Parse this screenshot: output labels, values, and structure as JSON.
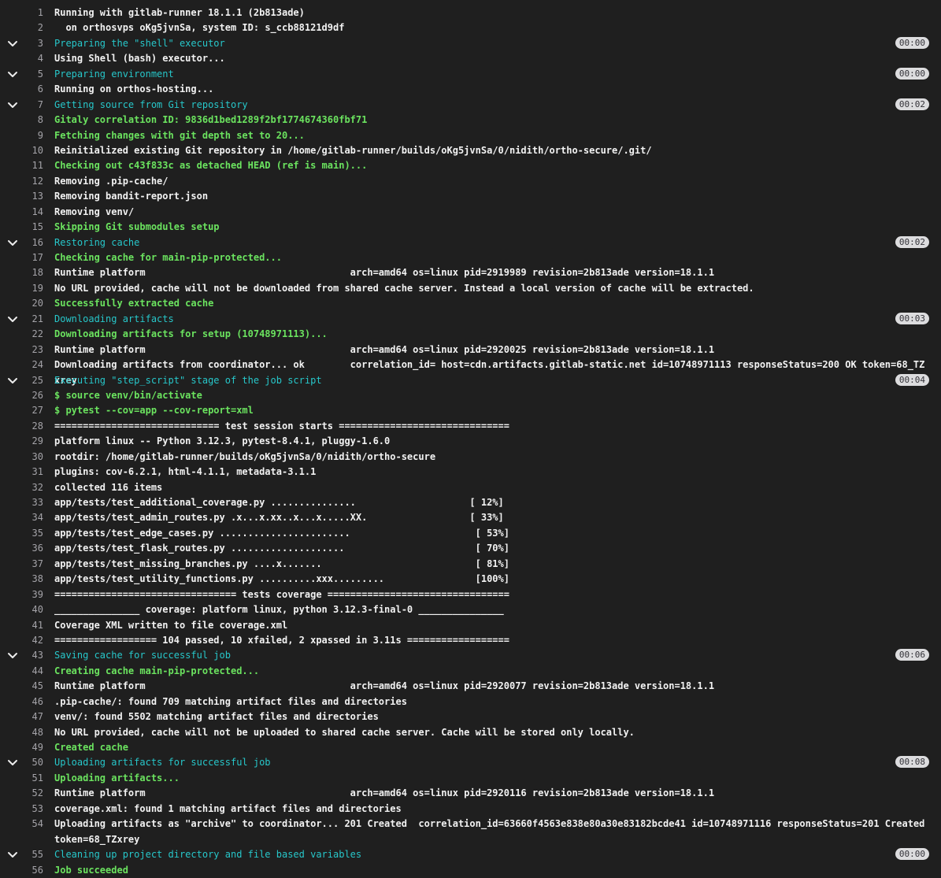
{
  "job_log": {
    "lines": [
      {
        "n": "1",
        "text": "Running with gitlab-runner 18.1.1 (2b813ade)",
        "c": "bold"
      },
      {
        "n": "2",
        "text": "  on orthosvps oKg5jvnSa, system ID: s_ccb88121d9df",
        "c": "bold"
      },
      {
        "n": "3",
        "text": "Preparing the \"shell\" executor",
        "c": "cyan",
        "section": true,
        "duration": "00:00"
      },
      {
        "n": "4",
        "text": "Using Shell (bash) executor...",
        "c": "bold"
      },
      {
        "n": "5",
        "text": "Preparing environment",
        "c": "cyan",
        "section": true,
        "duration": "00:00"
      },
      {
        "n": "6",
        "text": "Running on orthos-hosting...",
        "c": "bold"
      },
      {
        "n": "7",
        "text": "Getting source from Git repository",
        "c": "cyan",
        "section": true,
        "duration": "00:02"
      },
      {
        "n": "8",
        "text": "Gitaly correlation ID: 9836d1bed1289f2bf1774674360fbf71",
        "c": "green"
      },
      {
        "n": "9",
        "text": "Fetching changes with git depth set to 20...",
        "c": "green"
      },
      {
        "n": "10",
        "text": "Reinitialized existing Git repository in /home/gitlab-runner/builds/oKg5jvnSa/0/nidith/ortho-secure/.git/",
        "c": "bold"
      },
      {
        "n": "11",
        "text": "Checking out c43f833c as detached HEAD (ref is main)...",
        "c": "green"
      },
      {
        "n": "12",
        "text": "Removing .pip-cache/",
        "c": "bold"
      },
      {
        "n": "13",
        "text": "Removing bandit-report.json",
        "c": "bold"
      },
      {
        "n": "14",
        "text": "Removing venv/",
        "c": "bold"
      },
      {
        "n": "15",
        "text": "Skipping Git submodules setup",
        "c": "green"
      },
      {
        "n": "16",
        "text": "Restoring cache",
        "c": "cyan",
        "section": true,
        "duration": "00:02"
      },
      {
        "n": "17",
        "text": "Checking cache for main-pip-protected...",
        "c": "green"
      },
      {
        "n": "18",
        "text": "Runtime platform                                    arch=amd64 os=linux pid=2919989 revision=2b813ade version=18.1.1",
        "c": "bold"
      },
      {
        "n": "19",
        "text": "No URL provided, cache will not be downloaded from shared cache server. Instead a local version of cache will be extracted.",
        "c": "bold"
      },
      {
        "n": "20",
        "text": "Successfully extracted cache",
        "c": "green"
      },
      {
        "n": "21",
        "text": "Downloading artifacts",
        "c": "cyan",
        "section": true,
        "duration": "00:03"
      },
      {
        "n": "22",
        "text": "Downloading artifacts for setup (10748971113)...",
        "c": "green"
      },
      {
        "n": "23",
        "text": "Runtime platform                                    arch=amd64 os=linux pid=2920025 revision=2b813ade version=18.1.1",
        "c": "bold"
      },
      {
        "n": "24",
        "text": "Downloading artifacts from coordinator... ok        correlation_id= host=cdn.artifacts.gitlab-static.net id=10748971113 responseStatus=200 OK token=68_TZxrey",
        "c": "bold"
      },
      {
        "n": "25",
        "text": "Executing \"step_script\" stage of the job script",
        "c": "cyan",
        "section": true,
        "duration": "00:04"
      },
      {
        "n": "26",
        "text": "$ source venv/bin/activate",
        "c": "green"
      },
      {
        "n": "27",
        "text": "$ pytest --cov=app --cov-report=xml",
        "c": "green"
      },
      {
        "n": "28",
        "text": "============================= test session starts ==============================",
        "c": "bold"
      },
      {
        "n": "29",
        "text": "platform linux -- Python 3.12.3, pytest-8.4.1, pluggy-1.6.0",
        "c": "bold"
      },
      {
        "n": "30",
        "text": "rootdir: /home/gitlab-runner/builds/oKg5jvnSa/0/nidith/ortho-secure",
        "c": "bold"
      },
      {
        "n": "31",
        "text": "plugins: cov-6.2.1, html-4.1.1, metadata-3.1.1",
        "c": "bold"
      },
      {
        "n": "32",
        "text": "collected 116 items",
        "c": "bold"
      },
      {
        "n": "33",
        "text": "app/tests/test_additional_coverage.py ...............                    [ 12%]",
        "c": "bold"
      },
      {
        "n": "34",
        "text": "app/tests/test_admin_routes.py .x...x.xx..x...x.....XX.                  [ 33%]",
        "c": "bold"
      },
      {
        "n": "35",
        "text": "app/tests/test_edge_cases.py .......................                      [ 53%]",
        "c": "bold"
      },
      {
        "n": "36",
        "text": "app/tests/test_flask_routes.py ....................                       [ 70%]",
        "c": "bold"
      },
      {
        "n": "37",
        "text": "app/tests/test_missing_branches.py ....x.......                           [ 81%]",
        "c": "bold"
      },
      {
        "n": "38",
        "text": "app/tests/test_utility_functions.py ..........xxx.........                [100%]",
        "c": "bold"
      },
      {
        "n": "39",
        "text": "================================ tests coverage ================================",
        "c": "bold"
      },
      {
        "n": "40",
        "text": "_______________ coverage: platform linux, python 3.12.3-final-0 _______________",
        "c": "bold"
      },
      {
        "n": "41",
        "text": "Coverage XML written to file coverage.xml",
        "c": "bold"
      },
      {
        "n": "42",
        "text": "================== 104 passed, 10 xfailed, 2 xpassed in 3.11s ==================",
        "c": "bold"
      },
      {
        "n": "43",
        "text": "Saving cache for successful job",
        "c": "cyan",
        "section": true,
        "duration": "00:06"
      },
      {
        "n": "44",
        "text": "Creating cache main-pip-protected...",
        "c": "green"
      },
      {
        "n": "45",
        "text": "Runtime platform                                    arch=amd64 os=linux pid=2920077 revision=2b813ade version=18.1.1",
        "c": "bold"
      },
      {
        "n": "46",
        "text": ".pip-cache/: found 709 matching artifact files and directories",
        "c": "bold"
      },
      {
        "n": "47",
        "text": "venv/: found 5502 matching artifact files and directories",
        "c": "bold"
      },
      {
        "n": "48",
        "text": "No URL provided, cache will not be uploaded to shared cache server. Cache will be stored only locally.",
        "c": "bold"
      },
      {
        "n": "49",
        "text": "Created cache",
        "c": "green"
      },
      {
        "n": "50",
        "text": "Uploading artifacts for successful job",
        "c": "cyan",
        "section": true,
        "duration": "00:08"
      },
      {
        "n": "51",
        "text": "Uploading artifacts...",
        "c": "green"
      },
      {
        "n": "52",
        "text": "Runtime platform                                    arch=amd64 os=linux pid=2920116 revision=2b813ade version=18.1.1",
        "c": "bold"
      },
      {
        "n": "53",
        "text": "coverage.xml: found 1 matching artifact files and directories",
        "c": "bold"
      },
      {
        "n": "54",
        "text": "Uploading artifacts as \"archive\" to coordinator... 201 Created  correlation_id=63660f4563e838e80a30e83182bcde41 id=10748971116 responseStatus=201 Created token=68_TZxrey",
        "c": "bold",
        "wrap": true
      },
      {
        "n": "55",
        "text": "Cleaning up project directory and file based variables",
        "c": "cyan",
        "section": true,
        "duration": "00:00"
      },
      {
        "n": "56",
        "text": "Job succeeded",
        "c": "green"
      }
    ]
  },
  "icons": {
    "chevron": "chevron-down-icon"
  },
  "colors": {
    "background": "#1f1f1f",
    "text": "#ececec",
    "section_header": "#27c7ca",
    "success": "#6be35f",
    "line_number": "#a4a3a8",
    "duration_badge_bg": "#dcdcde",
    "duration_badge_text": "#333238"
  }
}
